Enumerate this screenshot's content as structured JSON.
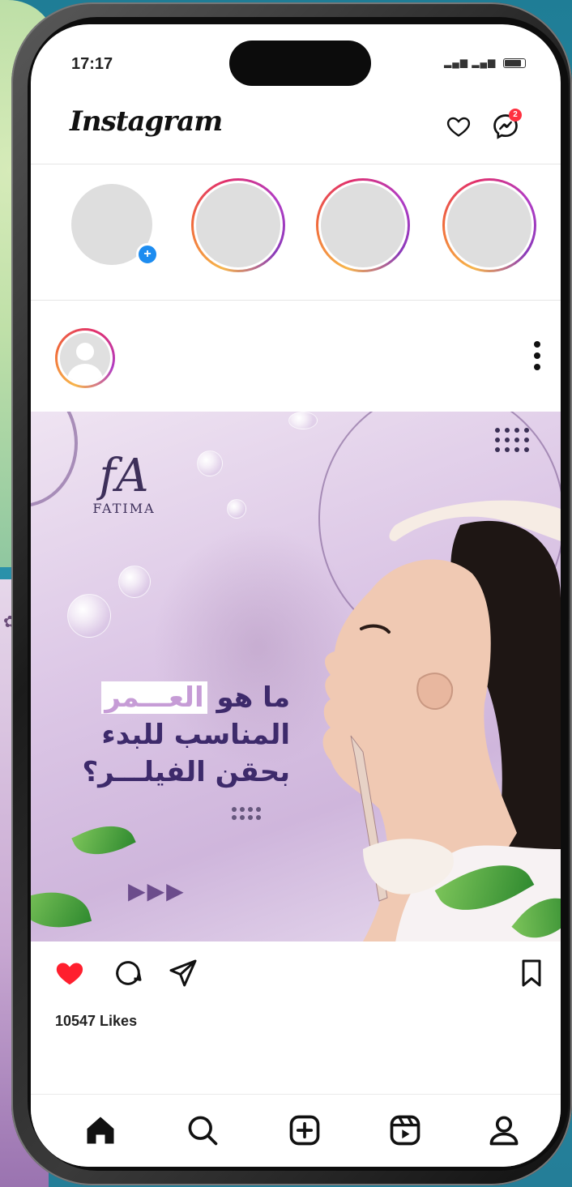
{
  "status_bar": {
    "time": "17:17"
  },
  "header": {
    "logo": "Instagram",
    "message_badge": "2"
  },
  "post": {
    "brand_mark": "fA",
    "brand_name": "FATIMA",
    "headline_line1_pre": "ما هو ",
    "headline_line1_hl": "العـــمر",
    "headline_line2": "المناسب للبدء",
    "headline_line3": "بحقن الفيلـــر؟",
    "arrows": "▶▶▶",
    "liked": true,
    "likes_text": "10547 Likes"
  },
  "colors": {
    "like_red": "#ff1f2e",
    "accent_purple": "#3d2a6b",
    "story_gradient": [
      "#f7b54a",
      "#e1306c",
      "#8a3ab9"
    ],
    "badge_red": "#ff3040",
    "add_blue": "#1d8cf0"
  },
  "icons": {
    "header": [
      "heart-icon",
      "messenger-icon"
    ],
    "post_actions": [
      "heart-filled-icon",
      "comment-icon",
      "share-icon",
      "bookmark-icon"
    ],
    "tabbar": [
      "home-icon",
      "search-icon",
      "create-icon",
      "reels-icon",
      "profile-icon"
    ]
  }
}
